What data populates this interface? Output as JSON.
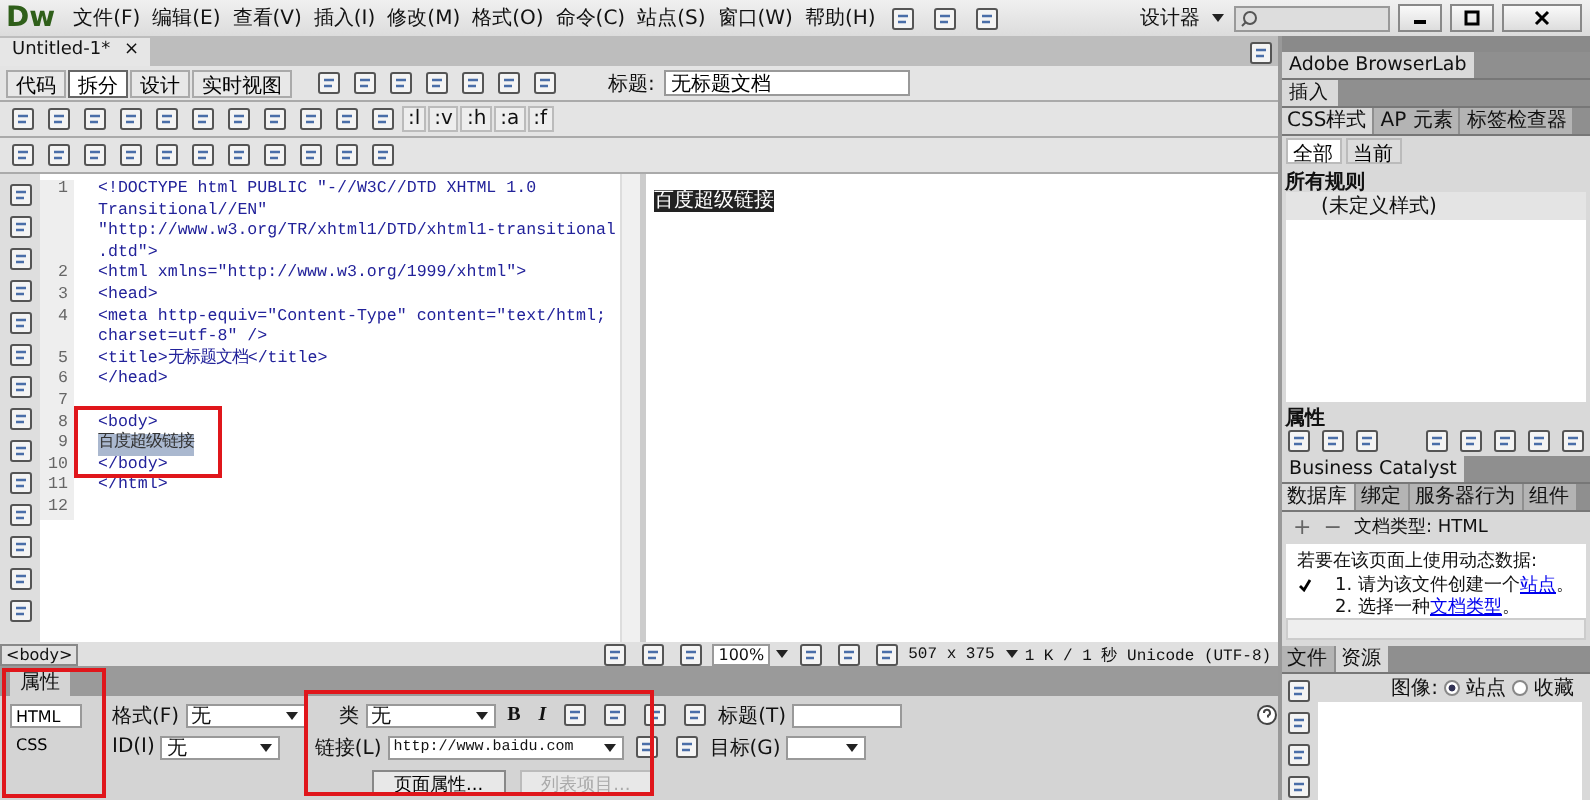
{
  "app": {
    "logo": "Dw",
    "menu": [
      "文件(F)",
      "编辑(E)",
      "查看(V)",
      "插入(I)",
      "修改(M)",
      "格式(O)",
      "命令(C)",
      "站点(S)",
      "窗口(W)",
      "帮助(H)"
    ],
    "workspace": "设计器"
  },
  "document_tab": {
    "title": "Untitled-1*",
    "close": "×"
  },
  "view_buttons": [
    {
      "label": "代码",
      "selected": false
    },
    {
      "label": "拆分",
      "selected": true
    },
    {
      "label": "设计",
      "selected": false
    },
    {
      "label": "实时视图",
      "selected": false
    }
  ],
  "title_field": {
    "label": "标题:",
    "value": "无标题文档"
  },
  "toolbar_labels": [
    ":l",
    ":v",
    ":h",
    ":a",
    ":f"
  ],
  "code": {
    "lines": [
      {
        "number": "1",
        "selected": false,
        "rows": [
          "<!DOCTYPE html PUBLIC \"-//W3C//DTD XHTML 1.0",
          "Transitional//EN\"",
          "\"http://www.w3.org/TR/xhtml1/DTD/xhtml1-transitional",
          ".dtd\">"
        ]
      },
      {
        "number": "2",
        "selected": false,
        "rows": [
          "<html xmlns=\"http://www.w3.org/1999/xhtml\">"
        ]
      },
      {
        "number": "3",
        "selected": false,
        "rows": [
          "<head>"
        ]
      },
      {
        "number": "4",
        "selected": false,
        "rows": [
          "<meta http-equiv=\"Content-Type\" content=\"text/html;",
          "charset=utf-8\" />"
        ]
      },
      {
        "number": "5",
        "selected": false,
        "rows": [
          "<title>无标题文档</title>"
        ]
      },
      {
        "number": "6",
        "selected": false,
        "rows": [
          "</head>"
        ]
      },
      {
        "number": "7",
        "selected": false
      },
      {
        "number": "8",
        "selected": false,
        "rows": [
          "<body>"
        ]
      },
      {
        "number": "9",
        "selected": true,
        "rows": [
          "百度超级链接"
        ]
      },
      {
        "number": "10",
        "selected": false,
        "rows": [
          "</body>"
        ]
      },
      {
        "number": "11",
        "selected": false,
        "rows": [
          "</html>"
        ]
      },
      {
        "number": "12",
        "selected": false
      }
    ]
  },
  "design": {
    "text": "百度超级链接",
    "selected": true
  },
  "status": {
    "tag": "<body>",
    "zoom": "100%",
    "size": "507 x 375",
    "info": "1 K / 1 秒 Unicode (UTF-8)"
  },
  "properties": {
    "title": "属性",
    "tabs": [
      {
        "label": "HTML",
        "selected": true
      },
      {
        "label": "CSS",
        "selected": false
      }
    ],
    "format": {
      "label": "格式(F)",
      "value": "无"
    },
    "id": {
      "label": "ID(I)",
      "value": "无"
    },
    "class": {
      "label": "类",
      "value": "无"
    },
    "bold": "B",
    "italic": "I",
    "heading": {
      "label": "标题(T)"
    },
    "link": {
      "label": "链接(L)",
      "value": "http://www.baidu.com"
    },
    "target": {
      "label": "目标(G)"
    },
    "buttons": [
      {
        "label": "页面属性...",
        "disabled": false
      },
      {
        "label": "列表项目...",
        "disabled": true
      }
    ]
  },
  "panels": {
    "browserlab": "Adobe BrowserLab",
    "insert": "插入",
    "css_tabs": [
      {
        "label": "CSS样式",
        "selected": true
      },
      {
        "label": "AP 元素",
        "selected": false
      },
      {
        "label": "标签检查器",
        "selected": false
      }
    ],
    "css_modes": [
      {
        "label": "全部",
        "selected": true
      },
      {
        "label": "当前",
        "selected": false
      }
    ],
    "rules_header": "所有规则",
    "rules": [
      "(未定义样式)"
    ],
    "properties_header": "属性",
    "business_catalyst": "Business Catalyst",
    "data_tabs": [
      {
        "label": "数据库",
        "selected": true
      },
      {
        "label": "绑定",
        "selected": false
      },
      {
        "label": "服务器行为",
        "selected": false
      },
      {
        "label": "组件",
        "selected": false
      }
    ],
    "plus": "+",
    "minus": "−",
    "doc_type": "文档类型: HTML",
    "intro": "若要在该页面上使用动态数据:",
    "steps": [
      {
        "checked": true,
        "text": "1. 请为该文件创建一个",
        "link": "站点",
        "end": "。"
      },
      {
        "checked": false,
        "text": "2. 选择一种",
        "link": "文档类型",
        "end": "。"
      }
    ],
    "file_tabs": [
      {
        "label": "文件",
        "selected": false
      },
      {
        "label": "资源",
        "selected": true
      }
    ],
    "assets_label": "图像:",
    "asset_options": [
      {
        "label": "站点",
        "selected": true
      },
      {
        "label": "收藏",
        "selected": false
      }
    ]
  }
}
